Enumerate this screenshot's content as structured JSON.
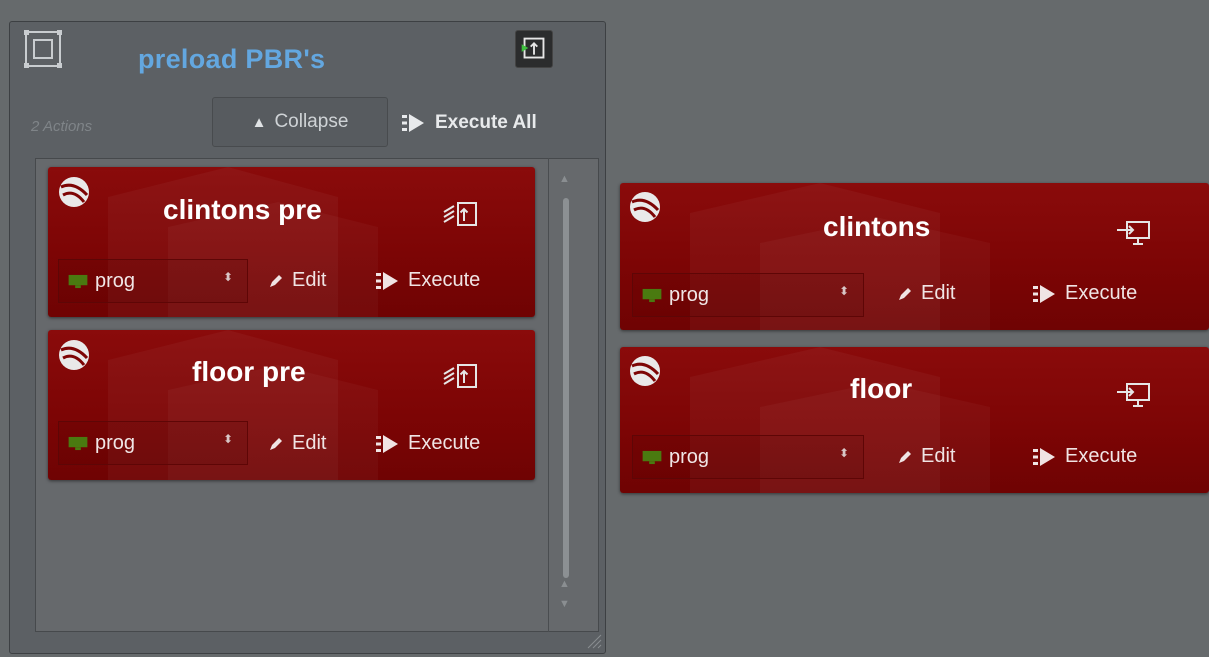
{
  "group": {
    "title": "preload PBR's",
    "actions_count": "2 Actions",
    "collapse_label": "Collapse",
    "execute_all_label": "Execute All"
  },
  "cards": [
    {
      "title": "clintons pre",
      "output": "prog",
      "edit_label": "Edit",
      "execute_label": "Execute",
      "action_icon": "preload-icon"
    },
    {
      "title": "floor pre",
      "output": "prog",
      "edit_label": "Edit",
      "execute_label": "Execute",
      "action_icon": "preload-icon"
    },
    {
      "title": "clintons",
      "output": "prog",
      "edit_label": "Edit",
      "execute_label": "Execute",
      "action_icon": "load-to-screen-icon"
    },
    {
      "title": "floor",
      "output": "prog",
      "edit_label": "Edit",
      "execute_label": "Execute",
      "action_icon": "load-to-screen-icon"
    }
  ],
  "colors": {
    "title_blue": "#63a7e0",
    "card_red": "#7d0505",
    "monitor_green": "#4a7a10"
  }
}
